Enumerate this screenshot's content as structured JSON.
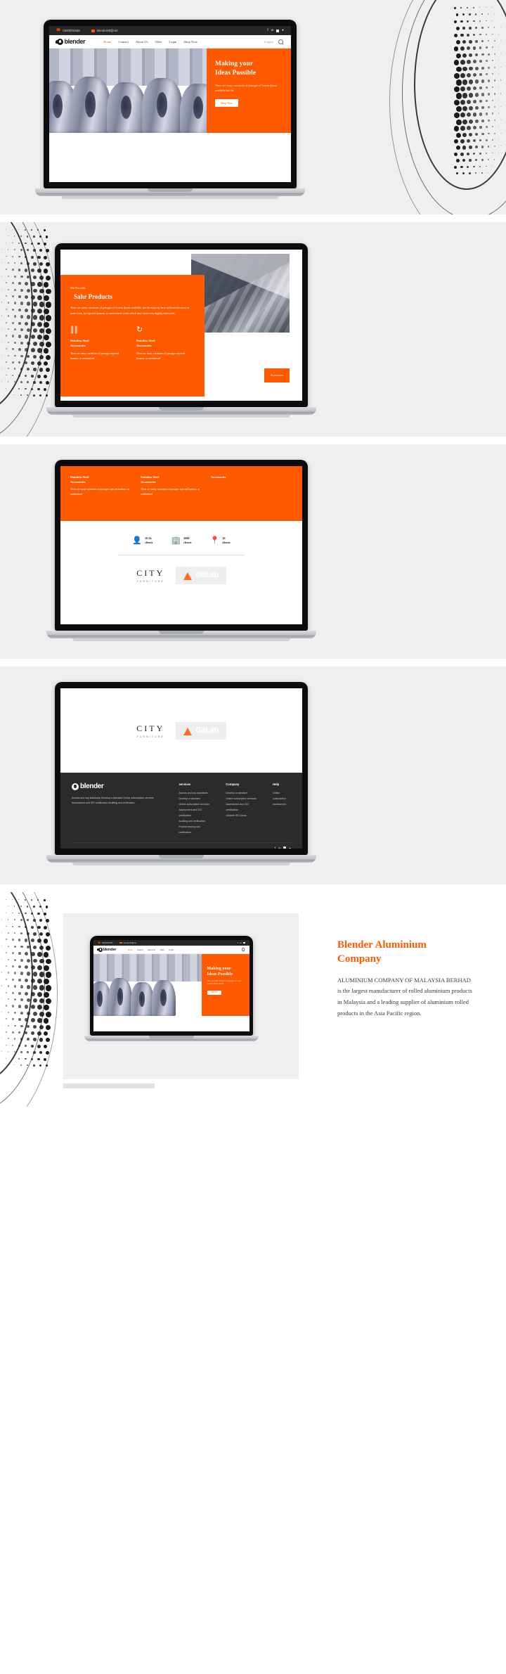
{
  "brand": {
    "name": "blender",
    "accent": "#ff5a00",
    "dark": "#262626"
  },
  "topbar": {
    "phone": "0320003456",
    "email": "blender90@net",
    "social": [
      "facebook-icon",
      "twitter-icon",
      "instagram-icon",
      "user-icon"
    ]
  },
  "nav": {
    "items": [
      {
        "label": "Home",
        "active": true
      },
      {
        "label": "Contact",
        "active": false
      },
      {
        "label": "About Us",
        "active": false
      },
      {
        "label": "Offer",
        "active": false
      },
      {
        "label": "Login",
        "active": false
      },
      {
        "label": "Shop Now",
        "active": false
      }
    ],
    "language": "English",
    "search_icon": "search-icon"
  },
  "hero": {
    "title_line1": "Making your",
    "title_line2": "Ideas Possible",
    "body": "There are many variations of passages of Lorem Ipsum available but the",
    "cta": "Shop Now"
  },
  "products": {
    "eyebrow": "We Provide",
    "heading": "Sahr Products",
    "lead": "There are many variations of passages of Lorem Ipsum available, but the majority have suffered alteration in some form, by injected humour, or randomised words which don't look even slightly believable.",
    "features": [
      {
        "icon": "rails-icon",
        "title_line1": "Stainless Steel",
        "title_line2": "Accessories",
        "body": "There are many variations of passages injected humour, or randomised"
      },
      {
        "icon": "recycle-icon",
        "title_line1": "Stainless Steel",
        "title_line2": "Accessories",
        "body": "There are many variations of passages injected humour, or randomised"
      }
    ],
    "photo_tag": "Accessories"
  },
  "features_continued": [
    {
      "title_line1": "Stainless Steel",
      "title_line2": "Accessories",
      "body": "There are many variations of passages injected humour, or randomised"
    },
    {
      "title_line1": "Stainless Steel",
      "title_line2": "Accessories",
      "body": "There are many variations of passages injected humour, or randomised"
    },
    {
      "title_line1": "Accessories",
      "title_line2": "",
      "body": ""
    }
  ],
  "stats": [
    {
      "icon": "user-icon",
      "value": "10.5k",
      "label": "clients"
    },
    {
      "icon": "building-icon",
      "value": "2000",
      "label": "clients"
    },
    {
      "icon": "location-pin-icon",
      "value": "10",
      "label": "clients"
    }
  ],
  "brands": {
    "city": {
      "name": "CITY",
      "sub": "FURNITURE"
    },
    "gitlab": {
      "name": "GitLab",
      "icon": "gitlab-fox-icon"
    }
  },
  "footer": {
    "logo": "blender",
    "about": "Access and buy standards Develop a standard Online subscription services Assessment and ISO certification Auditing and verification",
    "columns": [
      {
        "heading": "services",
        "links": [
          "Access and buy standards",
          "Develop a standard",
          "Online subscription services",
          "Assessment and ISO certification",
          "Auditing and verification",
          "Product testing and certification"
        ]
      },
      {
        "heading": "Company",
        "links": [
          "Develop a standard",
          "Online subscription services",
          "Assessment and ISO certification",
          "Validate ISO Areas"
        ]
      },
      {
        "heading": "Help",
        "links": [
          "Online subscription",
          "Assessment"
        ]
      }
    ],
    "social": [
      "facebook-icon",
      "twitter-icon",
      "instagram-icon",
      "user-icon"
    ]
  },
  "final": {
    "title_line1": "Blender Aluminium",
    "title_line2": "Company",
    "body": "ALUMINIUM COMPANY OF MALAYSIA BERHAD is the largest manufacturer of rolled aluminium products in Malaysia and a leading supplier of aluminium rolled products in the Asia Pacific region."
  }
}
